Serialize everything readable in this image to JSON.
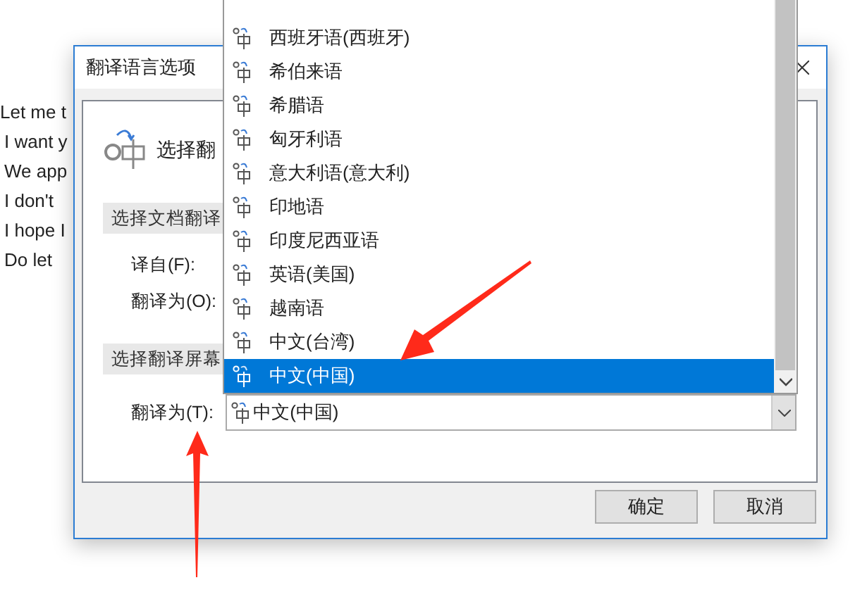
{
  "document_lines": [
    "Let me t",
    "I want y",
    "We app",
    "I don't",
    "I hope I",
    "Do let"
  ],
  "dialog": {
    "title": "翻译语言选项",
    "heading": "选择翻",
    "sections": [
      {
        "title": "选择文档翻译",
        "fields": [
          {
            "label": "译自(F):"
          },
          {
            "label": "翻译为(O):"
          }
        ]
      },
      {
        "title": "选择翻译屏幕",
        "fields": [
          {
            "label": "翻译为(T):",
            "value": "中文(中国)"
          }
        ]
      }
    ],
    "buttons": [
      "确定",
      "取消"
    ]
  },
  "dropdown": {
    "items": [
      {
        "label": "西班牙语(西班牙)",
        "selected": false
      },
      {
        "label": "希伯来语",
        "selected": false
      },
      {
        "label": "希腊语",
        "selected": false
      },
      {
        "label": "匈牙利语",
        "selected": false
      },
      {
        "label": "意大利语(意大利)",
        "selected": false
      },
      {
        "label": "印地语",
        "selected": false
      },
      {
        "label": "印度尼西亚语",
        "selected": false
      },
      {
        "label": "英语(美国)",
        "selected": false
      },
      {
        "label": "越南语",
        "selected": false
      },
      {
        "label": "中文(台湾)",
        "selected": false
      },
      {
        "label": "中文(中国)",
        "selected": true
      }
    ]
  }
}
